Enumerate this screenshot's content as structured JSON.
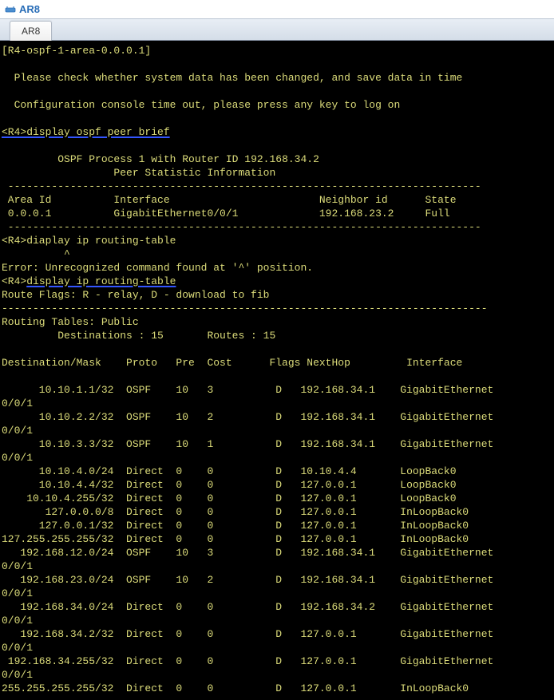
{
  "window": {
    "title": "AR8"
  },
  "tabs": {
    "active": "AR8"
  },
  "terminal": {
    "prompt_context": "[R4-ospf-1-area-0.0.0.1]",
    "msg_changed": "  Please check whether system data has been changed, and save data in time",
    "msg_timeout": "  Configuration console time out, please press any key to log on",
    "prompt": "<R4>",
    "cmd_ospf_peer": "display ospf peer brief",
    "ospf_hdr1": "\t OSPF Process 1 with Router ID 192.168.34.2",
    "ospf_hdr2": "\t\t  Peer Statistic Information",
    "dash_line": " ----------------------------------------------------------------------------",
    "ospf_cols": " Area Id          Interface                        Neighbor id      State",
    "ospf_row": " 0.0.0.1          GigabitEthernet0/0/1             192.168.23.2     Full",
    "cmd_typo": "diaplay ip routing-table",
    "caret_line": "          ^",
    "err_line": "Error: Unrecognized command found at '^' position.",
    "cmd_rt": "display ip routing-table",
    "route_flags": "Route Flags: R - relay, D - download to fib",
    "long_dash": "------------------------------------------------------------------------------",
    "rt_public": "Routing Tables: Public",
    "rt_counts": "         Destinations : 15       Routes : 15",
    "rt_cols": "Destination/Mask    Proto   Pre  Cost      Flags NextHop         Interface",
    "routes": [
      {
        "dest": "10.10.1.1/32",
        "proto": "OSPF",
        "pre": "10",
        "cost": "3",
        "flags": "D",
        "nexthop": "192.168.34.1",
        "iface": "GigabitEthernet",
        "wrap": "0/0/1"
      },
      {
        "dest": "10.10.2.2/32",
        "proto": "OSPF",
        "pre": "10",
        "cost": "2",
        "flags": "D",
        "nexthop": "192.168.34.1",
        "iface": "GigabitEthernet",
        "wrap": "0/0/1"
      },
      {
        "dest": "10.10.3.3/32",
        "proto": "OSPF",
        "pre": "10",
        "cost": "1",
        "flags": "D",
        "nexthop": "192.168.34.1",
        "iface": "GigabitEthernet",
        "wrap": "0/0/1"
      },
      {
        "dest": "10.10.4.0/24",
        "proto": "Direct",
        "pre": "0",
        "cost": "0",
        "flags": "D",
        "nexthop": "10.10.4.4",
        "iface": "LoopBack0",
        "wrap": ""
      },
      {
        "dest": "10.10.4.4/32",
        "proto": "Direct",
        "pre": "0",
        "cost": "0",
        "flags": "D",
        "nexthop": "127.0.0.1",
        "iface": "LoopBack0",
        "wrap": ""
      },
      {
        "dest": "10.10.4.255/32",
        "proto": "Direct",
        "pre": "0",
        "cost": "0",
        "flags": "D",
        "nexthop": "127.0.0.1",
        "iface": "LoopBack0",
        "wrap": ""
      },
      {
        "dest": "127.0.0.0/8",
        "proto": "Direct",
        "pre": "0",
        "cost": "0",
        "flags": "D",
        "nexthop": "127.0.0.1",
        "iface": "InLoopBack0",
        "wrap": ""
      },
      {
        "dest": "127.0.0.1/32",
        "proto": "Direct",
        "pre": "0",
        "cost": "0",
        "flags": "D",
        "nexthop": "127.0.0.1",
        "iface": "InLoopBack0",
        "wrap": ""
      },
      {
        "dest": "127.255.255.255/32",
        "proto": "Direct",
        "pre": "0",
        "cost": "0",
        "flags": "D",
        "nexthop": "127.0.0.1",
        "iface": "InLoopBack0",
        "wrap": ""
      },
      {
        "dest": "192.168.12.0/24",
        "proto": "OSPF",
        "pre": "10",
        "cost": "3",
        "flags": "D",
        "nexthop": "192.168.34.1",
        "iface": "GigabitEthernet",
        "wrap": "0/0/1"
      },
      {
        "dest": "192.168.23.0/24",
        "proto": "OSPF",
        "pre": "10",
        "cost": "2",
        "flags": "D",
        "nexthop": "192.168.34.1",
        "iface": "GigabitEthernet",
        "wrap": "0/0/1"
      },
      {
        "dest": "192.168.34.0/24",
        "proto": "Direct",
        "pre": "0",
        "cost": "0",
        "flags": "D",
        "nexthop": "192.168.34.2",
        "iface": "GigabitEthernet",
        "wrap": "0/0/1"
      },
      {
        "dest": "192.168.34.2/32",
        "proto": "Direct",
        "pre": "0",
        "cost": "0",
        "flags": "D",
        "nexthop": "127.0.0.1",
        "iface": "GigabitEthernet",
        "wrap": "0/0/1"
      },
      {
        "dest": "192.168.34.255/32",
        "proto": "Direct",
        "pre": "0",
        "cost": "0",
        "flags": "D",
        "nexthop": "127.0.0.1",
        "iface": "GigabitEthernet",
        "wrap": "0/0/1"
      },
      {
        "dest": "255.255.255.255/32",
        "proto": "Direct",
        "pre": "0",
        "cost": "0",
        "flags": "D",
        "nexthop": "127.0.0.1",
        "iface": "InLoopBack0",
        "wrap": ""
      }
    ]
  }
}
